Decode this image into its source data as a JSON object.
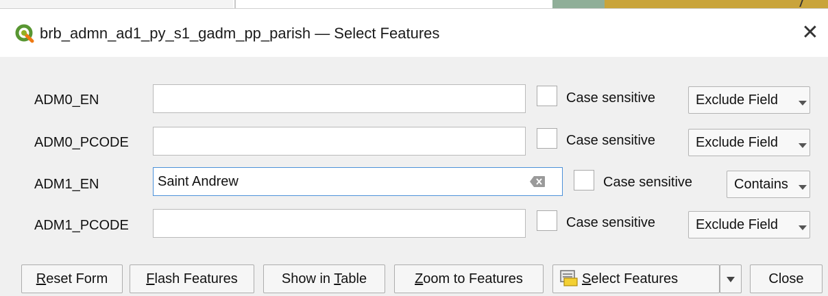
{
  "window": {
    "title": "brb_admn_ad1_py_s1_gadm_pp_parish — Select Features",
    "app_icon": "qgis-icon",
    "close_icon": "close-icon"
  },
  "fields": [
    {
      "label": "ADM0_EN",
      "value": "",
      "case_sensitive_label": "Case sensitive",
      "case_sensitive_checked": false,
      "operator": "Exclude Field"
    },
    {
      "label": "ADM0_PCODE",
      "value": "",
      "case_sensitive_label": "Case sensitive",
      "case_sensitive_checked": false,
      "operator": "Exclude Field"
    },
    {
      "label": "ADM1_EN",
      "value": "Saint Andrew",
      "case_sensitive_label": "Case sensitive",
      "case_sensitive_checked": false,
      "operator": "Contains"
    },
    {
      "label": "ADM1_PCODE",
      "value": "",
      "case_sensitive_label": "Case sensitive",
      "case_sensitive_checked": false,
      "operator": "Exclude Field"
    }
  ],
  "buttons": {
    "reset_form": {
      "mnemonic": "R",
      "rest": "eset Form"
    },
    "flash_features": {
      "mnemonic": "F",
      "rest": "lash Features"
    },
    "show_in_table": {
      "before": "Show in ",
      "mnemonic": "T",
      "rest": "able"
    },
    "zoom_to_features": {
      "mnemonic": "Z",
      "rest": "oom to Features"
    },
    "select_features": {
      "mnemonic": "S",
      "rest": "elect Features",
      "icon": "select-features-icon"
    },
    "close": "Close"
  }
}
